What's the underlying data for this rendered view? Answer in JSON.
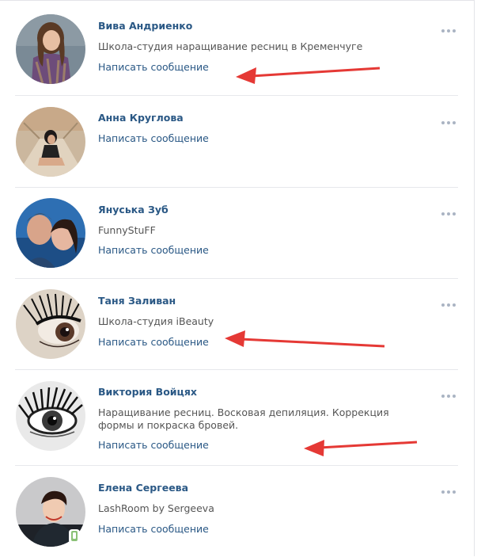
{
  "people": [
    {
      "name": "Вива Андриенко",
      "subtitle": "Школа-студия наращивание ресниц в Кременчуге",
      "action": "Написать сообщение",
      "avatar_icon": "user-photo-avatar"
    },
    {
      "name": "Анна Круглова",
      "subtitle": "",
      "action": "Написать сообщение",
      "avatar_icon": "user-photo-avatar"
    },
    {
      "name": "Януська Зуб",
      "subtitle": "FunnyStuFF",
      "action": "Написать сообщение",
      "avatar_icon": "user-photo-avatar"
    },
    {
      "name": "Таня Заливан",
      "subtitle": "Школа-студия iBeauty",
      "action": "Написать сообщение",
      "avatar_icon": "eyelash-photo-avatar"
    },
    {
      "name": "Виктория Войцях",
      "subtitle": "Наращивание ресниц. Восковая депиляция. Коррекция формы и покраска бровей.",
      "action": "Написать сообщение",
      "avatar_icon": "eye-photo-avatar"
    },
    {
      "name": "Елена Сергеева",
      "subtitle": "LashRoom by Sergeeva",
      "action": "Написать сообщение",
      "avatar_icon": "user-photo-avatar",
      "online_mobile": true
    }
  ],
  "colors": {
    "link": "#2a5885",
    "text": "#555555",
    "separator": "#e7e8ec",
    "more_dots": "#aab4c3",
    "arrow": "#e53935",
    "online": "#8ac176"
  },
  "icons": {
    "more": "more-dots-icon",
    "annotation_arrow": "red-arrow-icon",
    "online": "mobile-online-icon"
  }
}
